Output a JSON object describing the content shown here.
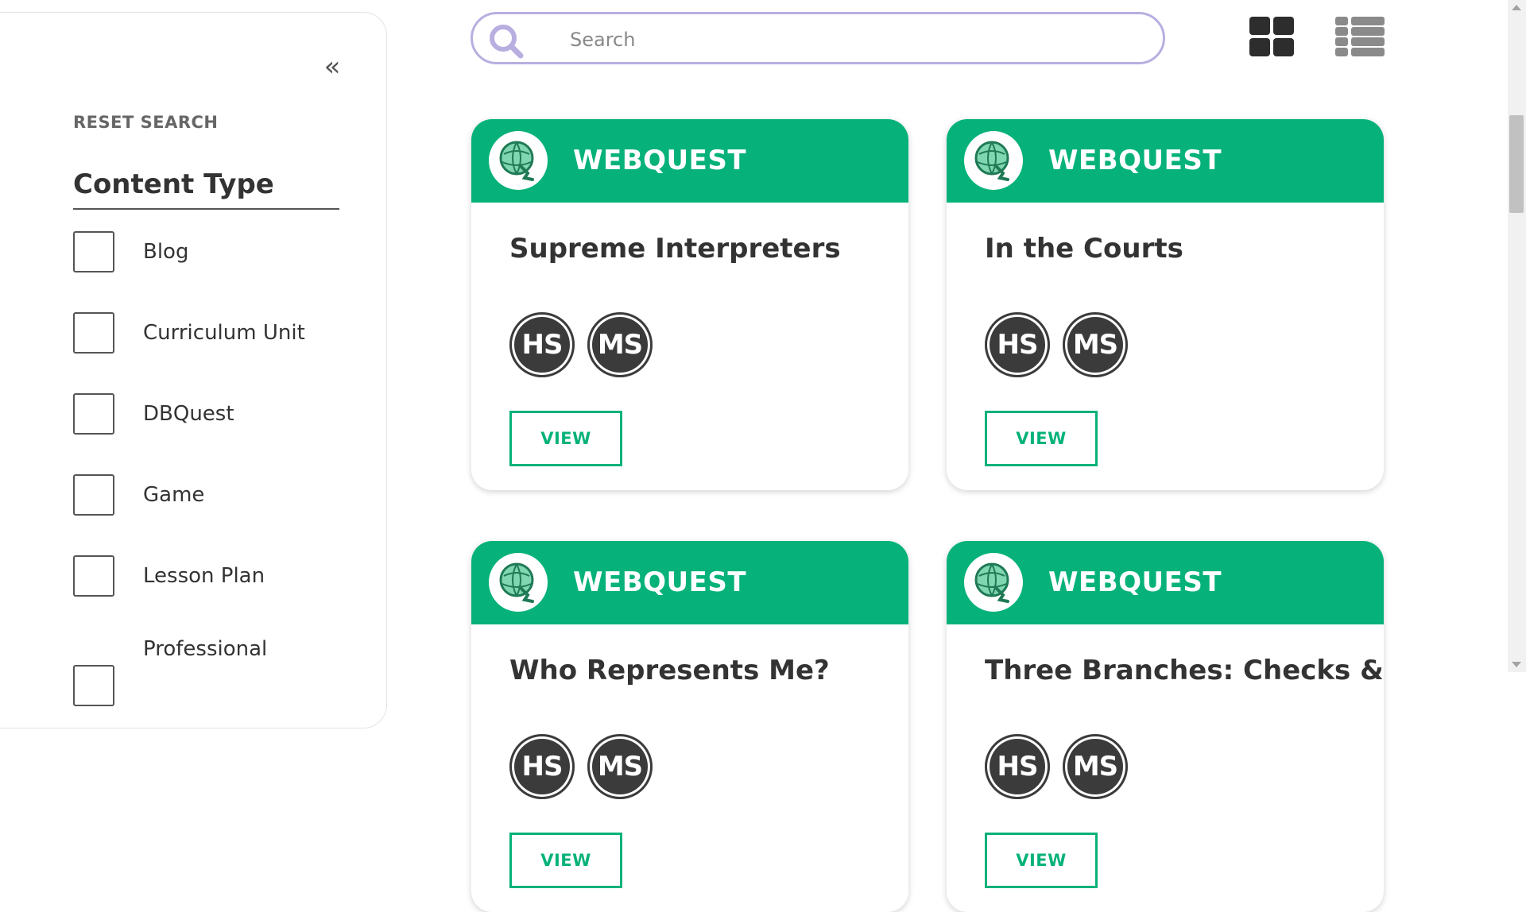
{
  "sidebar": {
    "reset_label": "RESET SEARCH",
    "content_type_heading": "Content Type",
    "filters": [
      {
        "label": "Blog",
        "checked": false
      },
      {
        "label": "Curriculum Unit",
        "checked": false
      },
      {
        "label": "DBQuest",
        "checked": false
      },
      {
        "label": "Game",
        "checked": false
      },
      {
        "label": "Lesson Plan",
        "checked": false
      },
      {
        "label": "Professional",
        "checked": false
      }
    ]
  },
  "search": {
    "placeholder": "Search",
    "value": ""
  },
  "view_toggle": {
    "grid_icon": "grid-view-icon",
    "list_icon": "list-view-icon"
  },
  "colors": {
    "accent": "#06b27a",
    "search_border": "#b9aee0",
    "badge": "#3b3b3b"
  },
  "cards": [
    {
      "type": "WEBQUEST",
      "title": "Supreme Interpreters",
      "badges": [
        "HS",
        "MS"
      ],
      "button": "VIEW"
    },
    {
      "type": "WEBQUEST",
      "title": "In the Courts",
      "badges": [
        "HS",
        "MS"
      ],
      "button": "VIEW"
    },
    {
      "type": "WEBQUEST",
      "title": "Who Represents Me?",
      "badges": [
        "HS",
        "MS"
      ],
      "button": "VIEW"
    },
    {
      "type": "WEBQUEST",
      "title": "Three Branches: Checks &",
      "badges": [
        "HS",
        "MS"
      ],
      "button": "VIEW"
    }
  ]
}
